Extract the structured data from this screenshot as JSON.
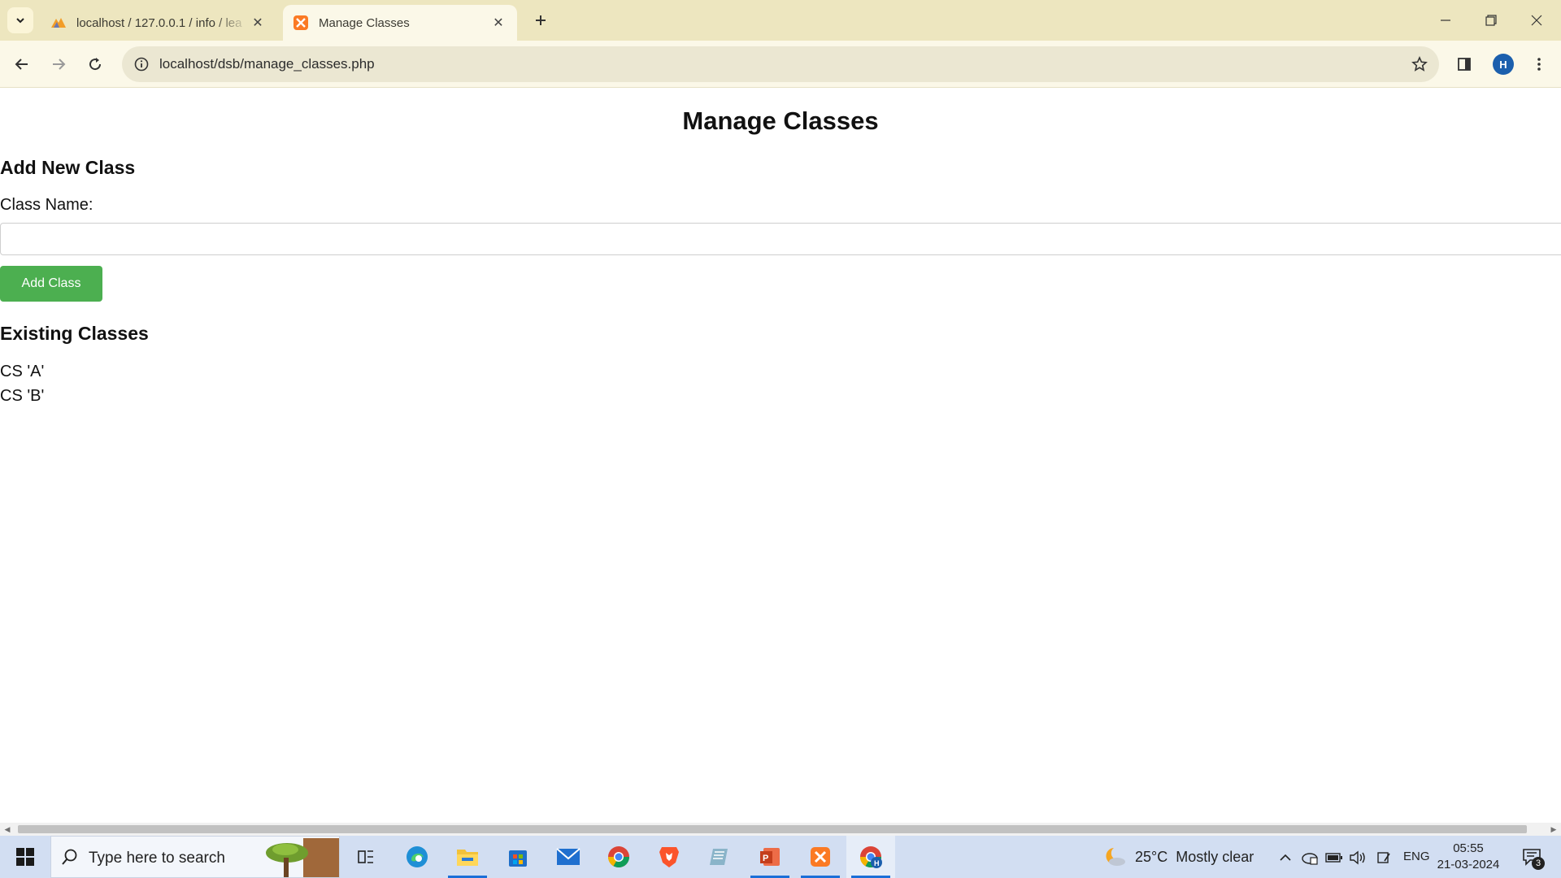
{
  "browser": {
    "tabs": [
      {
        "title": "localhost / 127.0.0.1 / info / lea",
        "active": false,
        "favicon": "phpmyadmin-icon"
      },
      {
        "title": "Manage Classes",
        "active": true,
        "favicon": "xampp-icon"
      }
    ],
    "url": "localhost/dsb/manage_classes.php",
    "profile_initial": "H"
  },
  "page": {
    "title": "Manage Classes",
    "add_section_heading": "Add New Class",
    "class_name_label": "Class Name:",
    "class_name_value": "",
    "add_button_label": "Add Class",
    "existing_heading": "Existing Classes",
    "classes": [
      "CS 'A'",
      "CS 'B'"
    ]
  },
  "taskbar": {
    "search_placeholder": "Type here to search",
    "weather_temp": "25°C",
    "weather_desc": "Mostly clear",
    "language": "ENG",
    "time": "05:55",
    "date": "21-03-2024",
    "notification_count": "3",
    "apps": [
      "task-view-icon",
      "edge-icon",
      "file-explorer-icon",
      "store-icon",
      "mail-icon",
      "chrome-icon",
      "brave-icon",
      "notepad-icon",
      "powerpoint-icon",
      "xampp-icon",
      "chrome-profile-icon"
    ]
  },
  "colors": {
    "tabbar_bg": "#ede6bf",
    "toolbar_bg": "#fbf8e8",
    "button_green": "#4caf50",
    "taskbar_bg": "#d2def2",
    "accent_blue": "#1b6fd8"
  }
}
